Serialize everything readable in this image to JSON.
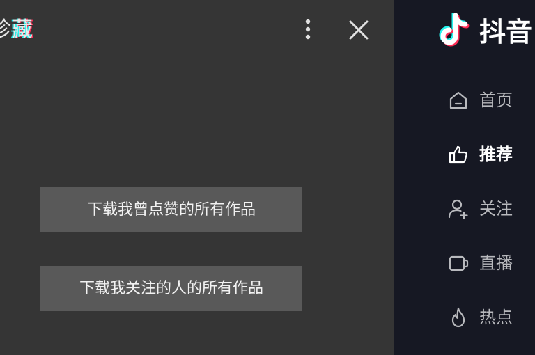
{
  "panel": {
    "title_prefix": "诊",
    "title_glitch": "藏",
    "more_icon": "more-vertical-icon",
    "close_icon": "close-icon",
    "buttons": [
      {
        "label": "下载我曾点赞的所有作品"
      },
      {
        "label": "下载我关注的人的所有作品"
      }
    ]
  },
  "sidebar": {
    "brand": {
      "logo_icon": "douyin-logo-icon",
      "name": "抖音"
    },
    "nav": [
      {
        "label": "首页",
        "icon": "home-icon",
        "active": false
      },
      {
        "label": "推荐",
        "icon": "thumbs-up-icon",
        "active": true
      },
      {
        "label": "关注",
        "icon": "user-plus-icon",
        "active": false
      },
      {
        "label": "直播",
        "icon": "live-tv-icon",
        "active": false
      },
      {
        "label": "热点",
        "icon": "flame-icon",
        "active": false
      }
    ]
  },
  "colors": {
    "panel_bg": "#353535",
    "button_bg": "#595959",
    "sidebar_bg": "#161823",
    "accent_cyan": "#25f4ee",
    "accent_red": "#fe2c55"
  }
}
